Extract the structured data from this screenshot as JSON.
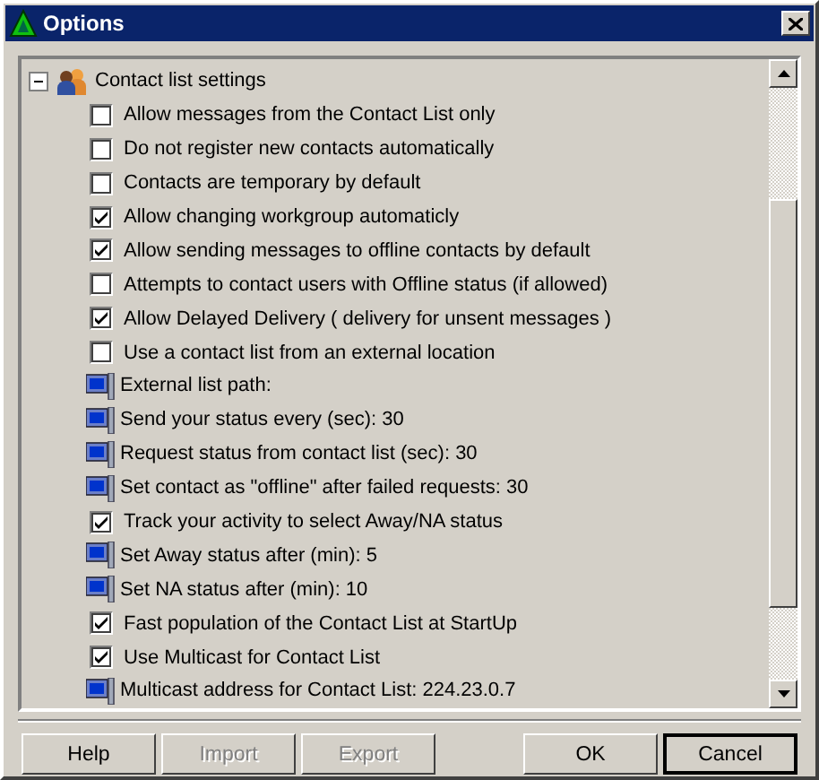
{
  "window": {
    "title": "Options"
  },
  "group": {
    "label": "Contact list settings",
    "expanded": true,
    "items": [
      {
        "kind": "checkbox",
        "label": "Allow messages from the Contact List only",
        "checked": false
      },
      {
        "kind": "checkbox",
        "label": "Do not register new contacts automatically",
        "checked": false
      },
      {
        "kind": "checkbox",
        "label": "Contacts are temporary by default",
        "checked": false
      },
      {
        "kind": "checkbox",
        "label": "Allow changing workgroup automaticly",
        "checked": true
      },
      {
        "kind": "checkbox",
        "label": "Allow sending messages to offline contacts by default",
        "checked": true
      },
      {
        "kind": "checkbox",
        "label": "Attempts to contact users with Offline status (if allowed)",
        "checked": false
      },
      {
        "kind": "checkbox",
        "label": "Allow Delayed Delivery ( delivery for unsent messages )",
        "checked": true
      },
      {
        "kind": "checkbox",
        "label": "Use a contact list from an external location",
        "checked": false
      },
      {
        "kind": "field",
        "label": "External list path:"
      },
      {
        "kind": "field",
        "label": "Send your status every (sec): 30"
      },
      {
        "kind": "field",
        "label": "Request status from contact list (sec): 30"
      },
      {
        "kind": "field",
        "label": "Set contact as \"offline\" after failed requests: 30"
      },
      {
        "kind": "checkbox",
        "label": "Track your activity to select Away/NA status",
        "checked": true
      },
      {
        "kind": "field",
        "label": "Set Away status after (min): 5"
      },
      {
        "kind": "field",
        "label": "Set NA status after (min): 10"
      },
      {
        "kind": "checkbox",
        "label": "Fast population of the Contact List at StartUp",
        "checked": true
      },
      {
        "kind": "checkbox",
        "label": "Use Multicast for Contact List",
        "checked": true
      },
      {
        "kind": "field",
        "label": "Multicast address for Contact List: 224.23.0.7"
      }
    ]
  },
  "buttons": [
    {
      "label": "Help",
      "disabled": false,
      "default": false
    },
    {
      "label": "Import",
      "disabled": true,
      "default": false
    },
    {
      "label": "Export",
      "disabled": true,
      "default": false
    },
    {
      "label": "OK",
      "disabled": false,
      "default": false
    },
    {
      "label": "Cancel",
      "disabled": false,
      "default": true
    }
  ]
}
